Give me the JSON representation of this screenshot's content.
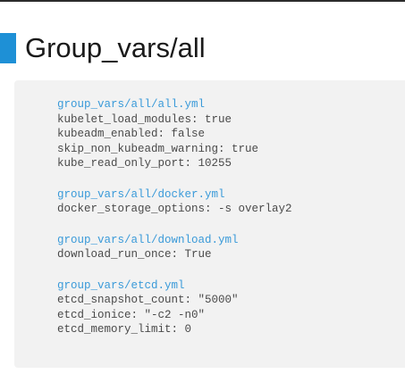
{
  "slide": {
    "title": "Group_vars/all"
  },
  "blocks": [
    {
      "file": "group_vars/all/all.yml",
      "lines": [
        "kubelet_load_modules: true",
        "kubeadm_enabled: false",
        "skip_non_kubeadm_warning: true",
        "kube_read_only_port: 10255"
      ]
    },
    {
      "file": "group_vars/all/docker.yml",
      "lines": [
        "docker_storage_options: -s overlay2"
      ]
    },
    {
      "file": "group_vars/all/download.yml",
      "lines": [
        "download_run_once: True"
      ]
    },
    {
      "file": "group_vars/etcd.yml",
      "lines": [
        "etcd_snapshot_count: \"5000\"",
        "etcd_ionice: \"-c2 -n0\"",
        "etcd_memory_limit: 0"
      ]
    }
  ],
  "colors": {
    "accent": "#1e90d6",
    "file_path": "#3a9ad9",
    "code_text": "#4a4a4a",
    "code_bg": "#f2f2f2"
  }
}
